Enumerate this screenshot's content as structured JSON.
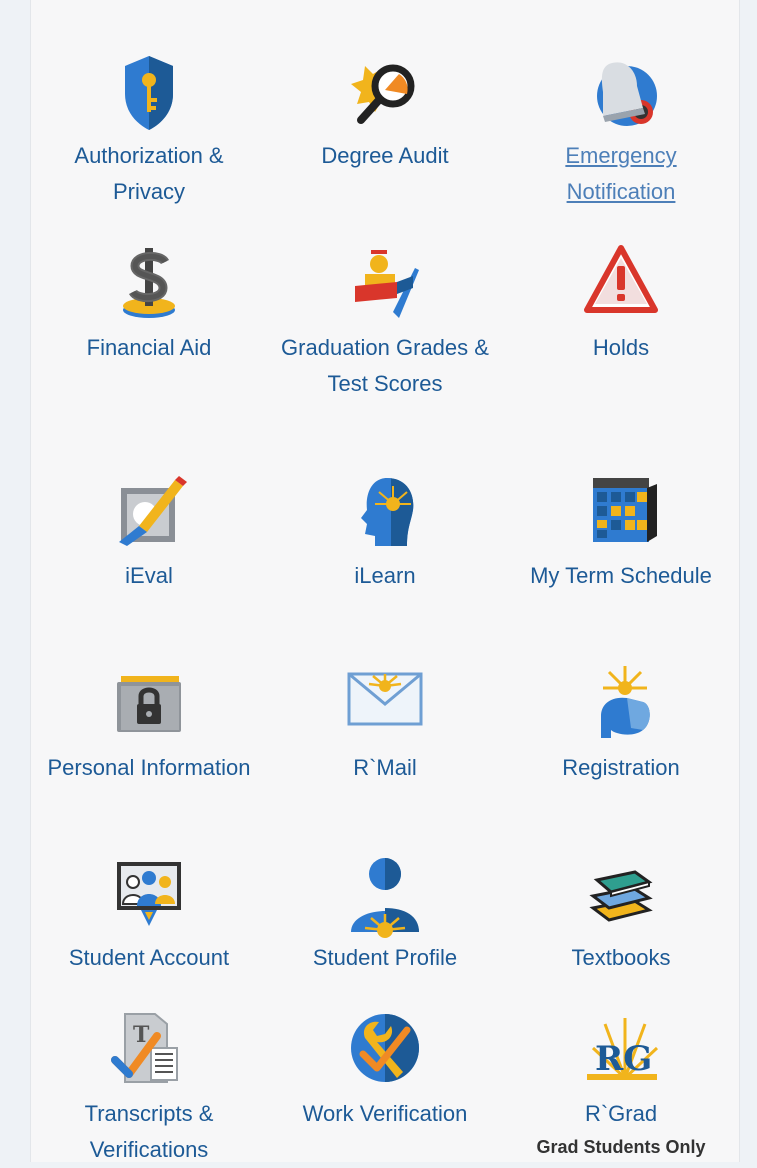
{
  "tiles": [
    {
      "label": "Authorization & Privacy",
      "icon": "shield-key-icon"
    },
    {
      "label": "Degree Audit",
      "icon": "magnifier-icon"
    },
    {
      "label": "Emergency Notification",
      "icon": "bell-icon"
    },
    {
      "label": "Financial Aid",
      "icon": "dollar-coin-icon"
    },
    {
      "label": "Graduation Grades & Test Scores",
      "icon": "graduate-icon"
    },
    {
      "label": "Holds",
      "icon": "warning-icon"
    },
    {
      "label": "iEval",
      "icon": "edit-pencil-icon"
    },
    {
      "label": "iLearn",
      "icon": "head-sun-icon"
    },
    {
      "label": "My Term Schedule",
      "icon": "calendar-icon"
    },
    {
      "label": "Personal Information",
      "icon": "lock-folder-icon"
    },
    {
      "label": "R`Mail",
      "icon": "mail-icon"
    },
    {
      "label": "Registration",
      "icon": "hand-sun-icon"
    },
    {
      "label": "Student Account",
      "icon": "people-board-icon"
    },
    {
      "label": "Student Profile",
      "icon": "person-profile-icon"
    },
    {
      "label": "Textbooks",
      "icon": "books-icon"
    },
    {
      "label": "Transcripts & Verifications",
      "icon": "transcript-icon"
    },
    {
      "label": "Work Verification",
      "icon": "wrench-icon"
    },
    {
      "label": "R`Grad",
      "icon": "rgrad-logo-icon",
      "sublabel": "Grad Students Only"
    }
  ],
  "colors": {
    "link": "#1d5a96",
    "link_underlined": "#4d7fb8",
    "accent_blue": "#2f7bd0",
    "accent_gold": "#f1b41c",
    "alert_red": "#d9362b"
  }
}
